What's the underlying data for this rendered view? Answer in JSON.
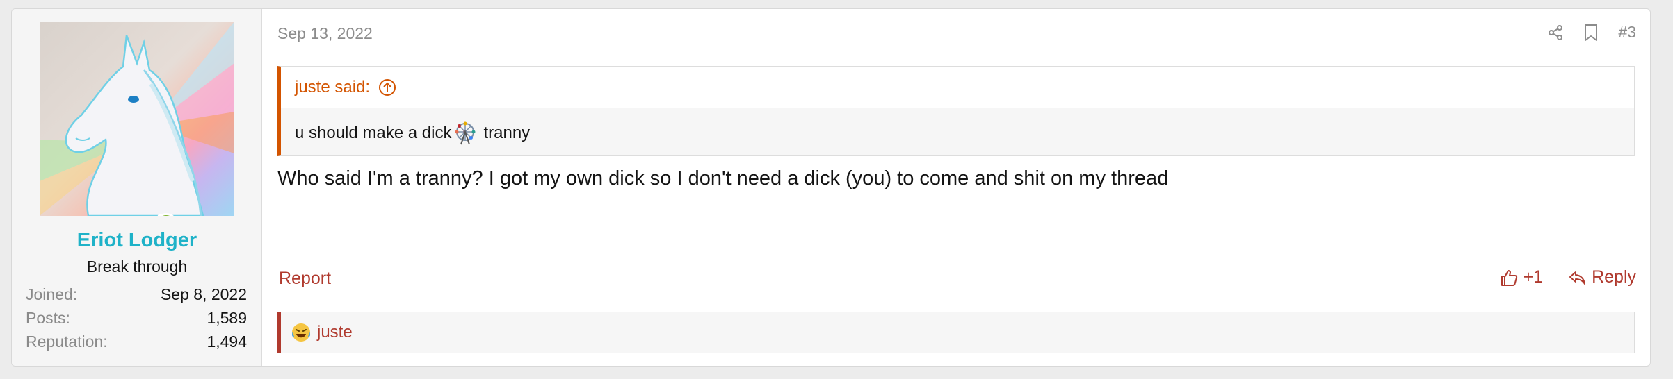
{
  "post": {
    "author": {
      "username": "Eriot Lodger",
      "user_title": "Break through",
      "stats": [
        {
          "label": "Joined:",
          "value": "Sep 8, 2022"
        },
        {
          "label": "Posts:",
          "value": "1,589"
        },
        {
          "label": "Reputation:",
          "value": "1,494"
        }
      ],
      "online_status": "online"
    },
    "date": "Sep 13, 2022",
    "post_number": "#3",
    "quote": {
      "attribution": "juste said:",
      "text_before": "u should make a dick",
      "text_after": "tranny"
    },
    "message": "Who said I'm a tranny? I got my own dick so I don't need a dick (you) to come and shit on my thread",
    "actions": {
      "report": "Report",
      "like": "+1",
      "reply": "Reply"
    },
    "reactions": {
      "users": "juste"
    }
  },
  "colors": {
    "username": "#1fb2c8",
    "link_red": "#b03a2e",
    "quote_orange": "#d35400",
    "online_green": "#7fb431"
  }
}
